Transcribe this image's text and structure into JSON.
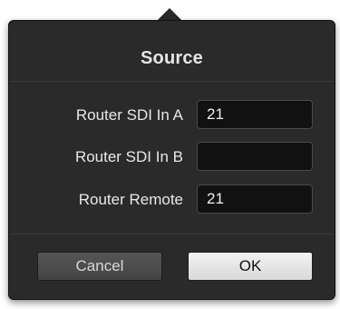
{
  "dialog": {
    "title": "Source"
  },
  "fields": [
    {
      "label": "Router SDI In A",
      "value": "21"
    },
    {
      "label": "Router SDI In B",
      "value": ""
    },
    {
      "label": "Router Remote",
      "value": "21"
    }
  ],
  "buttons": {
    "cancel_label": "Cancel",
    "ok_label": "OK"
  }
}
